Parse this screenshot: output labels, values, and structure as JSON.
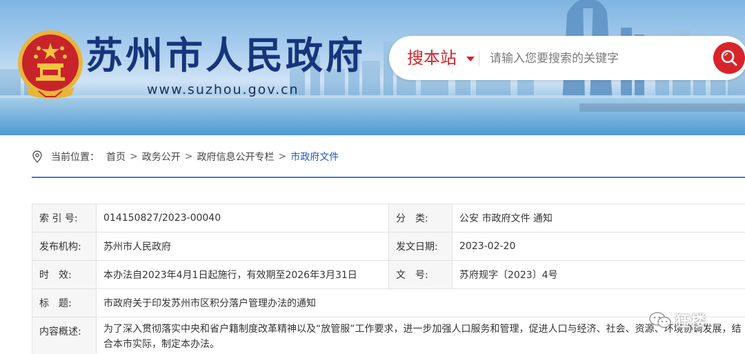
{
  "header": {
    "site_title": "苏州市人民政府",
    "site_url": "www.suzhou.gov.cn",
    "emblem_icon": "national-emblem-icon",
    "brand_color": "#16357a"
  },
  "search": {
    "scope_label": "搜本站",
    "placeholder": "请输入您要搜索的关键字",
    "accent_color": "#d8232a"
  },
  "breadcrumb": {
    "label": "当前位置：",
    "items": [
      "首页",
      "政务公开",
      "政府信息公开专栏"
    ],
    "separator": ">",
    "current": "市政府文件"
  },
  "info": {
    "index_label": "索 引 号:",
    "index_value": "014150827/2023-00040",
    "category_label": "分　类:",
    "category_value": "公安 市政府文件 通知",
    "issuer_label": "发布机构:",
    "issuer_value": "苏州市人民政府",
    "date_label": "发文日期:",
    "date_value": "2023-02-20",
    "validity_label": "时　效:",
    "validity_value": "本办法自2023年4月1日起施行，有效期至2026年3月31日",
    "docno_label": "文　号:",
    "docno_value": "苏府规字〔2023〕4号",
    "title_label": "标　题:",
    "title_value": "市政府关于印发苏州市区积分落户管理办法的通知",
    "summary_label": "内容概述:",
    "summary_value": "为了深入贯彻落实中央和省户籍制度改革精神以及“放管服”工作要求，进一步加强人口服务和管理，促进人口与经济、社会、资源、环境协调发展，结合本市实际，制定本办法。"
  },
  "watermark": {
    "text": "狂楼",
    "icon": "wechat-icon"
  }
}
